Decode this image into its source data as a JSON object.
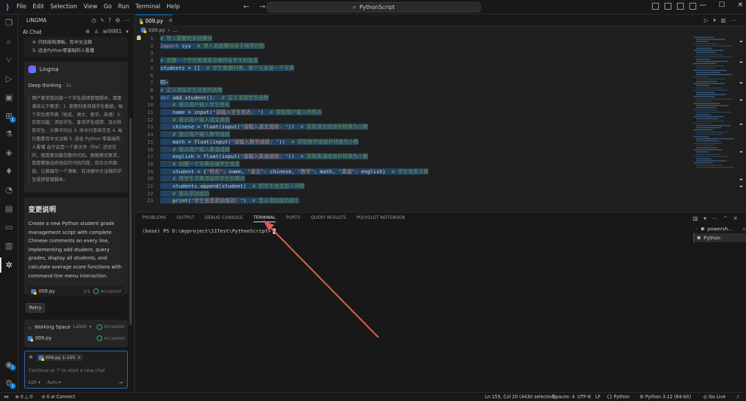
{
  "titlebar": {
    "menu": [
      "File",
      "Edit",
      "Selection",
      "View",
      "Go",
      "Run",
      "Terminal",
      "Help"
    ],
    "search_text": "PythonScript"
  },
  "sidebar": {
    "header_title": "LINGMA",
    "chat_tab": "AI Chat",
    "user": "wl9981",
    "prev_lines": [
      "4. 代码结构清晰，有中文注释",
      "5. 适合Python零基础的人看懂"
    ],
    "agent_name": "Lingma",
    "deep_thinking_label": "Deep thinking",
    "deep_thinking_time": "· 2s",
    "thinking_text": "用户要求我创建一个学生成绩管理脚本，需要满足以下要求：1. 使用列表存储学生数据，每个学生用字典（姓名、语文、数学、英语）2. 实现功能：添加学生、查询学生成绩、显示所有学生、计算平均分 3. 命令行菜单交互 4. 每行都要有中文注释 5. 适合 Python 零基础的人看懂 由于这是一个新文件（file）还没空的，我需要创建完整的代码。根据格式要求，我需要输出修改后的代码内容，包含文件路径。让我编写一个清晰、有详细中文注释的学生成绩管理脚本。",
    "change_title": "变更说明",
    "change_body": "Create a new Python student grade management script with complete Chinese comments on every line, implementing add student, query grades, display all students, and calculate average score functions with command-line menu interaction.",
    "file_chip": {
      "name": "009.py",
      "count": "1/1",
      "status": "Accepted"
    },
    "retry_label": "Retry",
    "working_space": {
      "label": "Working Space",
      "version": "Latest",
      "status": "Accepted",
      "file": "009.py",
      "file_status": "Accepted"
    },
    "input": {
      "context_chip": "009.py 1-155",
      "placeholder": "Continue or '/' to start a new chat",
      "mode": "Edit",
      "model": "Auto"
    }
  },
  "editor": {
    "tab_label": "009.py",
    "breadcrumb": [
      "009.py",
      "..."
    ],
    "lines": [
      {
        "n": "1",
        "segs": [
          [
            "c",
            "# 导入需要的系统模块"
          ]
        ]
      },
      {
        "n": "2",
        "segs": [
          [
            "kc",
            "import"
          ],
          [
            "p",
            " "
          ],
          [
            "v",
            "sys"
          ],
          [
            "p",
            "  "
          ],
          [
            "c",
            "# 导入系统模块用于程序控制"
          ]
        ]
      },
      {
        "n": "3",
        "segs": []
      },
      {
        "n": "4",
        "segs": [
          [
            "c",
            "# 创建一个空列表用来存储所有学生的信息"
          ]
        ]
      },
      {
        "n": "5",
        "segs": [
          [
            "v",
            "students"
          ],
          [
            "p",
            " = []  "
          ],
          [
            "c",
            "# 学生数据列表，每个元素是一个字典"
          ]
        ]
      },
      {
        "n": "6",
        "segs": []
      },
      {
        "n": "7",
        "segs": [
          [
            "p",
            "叩~"
          ]
        ]
      },
      {
        "n": "8",
        "segs": [
          [
            "c",
            "# 定义添加学生信息的函数"
          ]
        ]
      },
      {
        "n": "9",
        "segs": [
          [
            "k",
            "def"
          ],
          [
            "p",
            " "
          ],
          [
            "f",
            "add_student"
          ],
          [
            "p",
            "():  "
          ],
          [
            "c",
            "# 定义添加学生函数"
          ]
        ]
      },
      {
        "n": "10",
        "segs": [
          [
            "p",
            "    "
          ],
          [
            "c",
            "# 提示用户输入学生姓名"
          ]
        ]
      },
      {
        "n": "11",
        "segs": [
          [
            "p",
            "    "
          ],
          [
            "v",
            "name"
          ],
          [
            "p",
            " = "
          ],
          [
            "f",
            "input"
          ],
          [
            "p",
            "("
          ],
          [
            "s",
            "\"请输入学生姓名: \""
          ],
          [
            "p",
            ")  "
          ],
          [
            "c",
            "# 获取用户输入的姓名"
          ]
        ]
      },
      {
        "n": "12",
        "segs": [
          [
            "p",
            "    "
          ],
          [
            "c",
            "# 提示用户输入语文成绩"
          ]
        ]
      },
      {
        "n": "13",
        "segs": [
          [
            "p",
            "    "
          ],
          [
            "v",
            "chinese"
          ],
          [
            "p",
            " = "
          ],
          [
            "f",
            "float"
          ],
          [
            "p",
            "("
          ],
          [
            "f",
            "input"
          ],
          [
            "p",
            "("
          ],
          [
            "s",
            "\"请输入语文成绩: \""
          ],
          [
            "p",
            "))  "
          ],
          [
            "c",
            "# 获取语文成绩并转换为小数"
          ]
        ]
      },
      {
        "n": "14",
        "segs": [
          [
            "p",
            "    "
          ],
          [
            "c",
            "# 提示用户输入数学成绩"
          ]
        ]
      },
      {
        "n": "15",
        "segs": [
          [
            "p",
            "    "
          ],
          [
            "v",
            "math"
          ],
          [
            "p",
            " = "
          ],
          [
            "f",
            "float"
          ],
          [
            "p",
            "("
          ],
          [
            "f",
            "input"
          ],
          [
            "p",
            "("
          ],
          [
            "s",
            "\"请输入数学成绩: \""
          ],
          [
            "p",
            "))  "
          ],
          [
            "c",
            "# 获取数学成绩并转换为小数"
          ]
        ]
      },
      {
        "n": "16",
        "segs": [
          [
            "p",
            "    "
          ],
          [
            "c",
            "# 提示用户输入英语成绩"
          ]
        ]
      },
      {
        "n": "17",
        "segs": [
          [
            "p",
            "    "
          ],
          [
            "v",
            "english"
          ],
          [
            "p",
            " = "
          ],
          [
            "f",
            "float"
          ],
          [
            "p",
            "("
          ],
          [
            "f",
            "input"
          ],
          [
            "p",
            "("
          ],
          [
            "s",
            "\"请输入英语成绩: \""
          ],
          [
            "p",
            "))  "
          ],
          [
            "c",
            "# 获取英语成绩并转换为小数"
          ]
        ]
      },
      {
        "n": "18",
        "segs": [
          [
            "p",
            "    "
          ],
          [
            "c",
            "# 创建一个字典存储学生信息"
          ]
        ]
      },
      {
        "n": "19",
        "segs": [
          [
            "p",
            "    "
          ],
          [
            "v",
            "student"
          ],
          [
            "p",
            " = {"
          ],
          [
            "s",
            "\"姓名\""
          ],
          [
            "p",
            ": name, "
          ],
          [
            "s",
            "\"语文\""
          ],
          [
            "p",
            ": chinese, "
          ],
          [
            "s",
            "\"数学\""
          ],
          [
            "p",
            ": math, "
          ],
          [
            "s",
            "\"英语\""
          ],
          [
            "p",
            ": english}  "
          ],
          [
            "c",
            "# 学生信息字典"
          ]
        ]
      },
      {
        "n": "20",
        "segs": [
          [
            "p",
            "    "
          ],
          [
            "c",
            "# 将学生字典添加到学生列表中"
          ]
        ]
      },
      {
        "n": "21",
        "segs": [
          [
            "p",
            "    "
          ],
          [
            "v",
            "students"
          ],
          [
            "p",
            "."
          ],
          [
            "f",
            "append"
          ],
          [
            "p",
            "(student)  "
          ],
          [
            "c",
            "# 把学生信息加入列表"
          ]
        ]
      },
      {
        "n": "22",
        "segs": [
          [
            "p",
            "    "
          ],
          [
            "c",
            "# 提示添加成功"
          ]
        ]
      },
      {
        "n": "23",
        "segs": [
          [
            "p",
            "    "
          ],
          [
            "f",
            "print"
          ],
          [
            "p",
            "("
          ],
          [
            "s",
            "\"学生信息添加成功！\""
          ],
          [
            "p",
            ")  "
          ],
          [
            "c",
            "# 显示添加成功提示"
          ]
        ]
      }
    ]
  },
  "panel": {
    "tabs": [
      "PROBLEMS",
      "OUTPUT",
      "DEBUG CONSOLE",
      "TERMINAL",
      "PORTS",
      "QUERY RESULTS",
      "POLYGLOT NOTEBOOK"
    ],
    "active_tab": "TERMINAL",
    "prompt": "(base) PS D:\\myproject\\11Test\\PythonScript>",
    "terminals": [
      "powersh...",
      "Python"
    ]
  },
  "statusbar": {
    "errors": "0",
    "warnings": "0",
    "ports": "0",
    "connect": "Connect",
    "position": "Ln 155, Col 20 (4430 selected)",
    "spaces": "Spaces: 4",
    "encoding": "UTF-8",
    "eol": "LF",
    "language": "Python",
    "interpreter": "Python 3.12 (64-bit)",
    "golive": "Go Live"
  },
  "colors": {
    "accent": "#0078d4",
    "annotation_arrow": "#e05a52",
    "editor_bg": "#1f1f1f"
  }
}
